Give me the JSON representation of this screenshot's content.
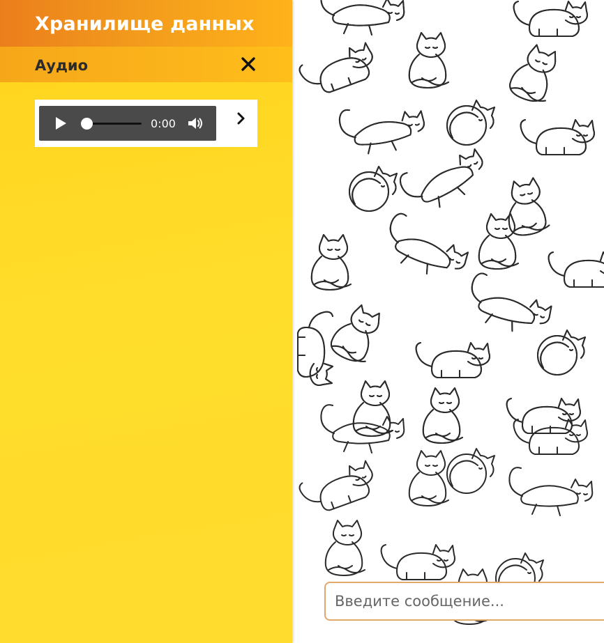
{
  "storage": {
    "title": "Хранилище данных",
    "section_title": "Аудио",
    "close_icon": "close-icon"
  },
  "audio_player": {
    "time": "0:00",
    "progress": 0,
    "icons": [
      "play-icon",
      "volume-icon",
      "chevron-right-icon"
    ]
  },
  "chat": {
    "background": "cat-doodle-pattern",
    "input_placeholder": "Введите сообщение..."
  },
  "colors": {
    "header_orange": "#f29a1c",
    "section_orange": "#fbb41b",
    "panel_yellow": "#ffdc2a",
    "player_gray": "#4a4a4a",
    "input_border": "#e2a76a"
  }
}
